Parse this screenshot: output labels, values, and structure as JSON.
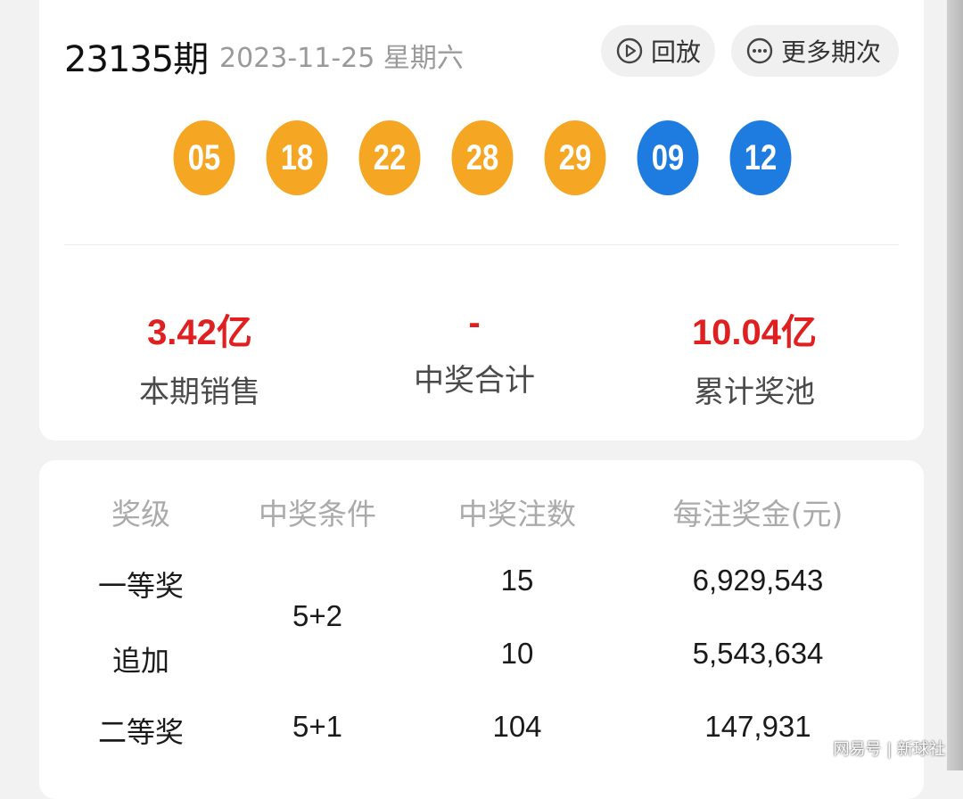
{
  "header": {
    "issue": "23135期",
    "date": "2023-11-25 星期六",
    "replay_label": "回放",
    "more_label": "更多期次"
  },
  "balls": {
    "front": [
      "05",
      "18",
      "22",
      "28",
      "29"
    ],
    "back": [
      "09",
      "12"
    ],
    "colors": {
      "front": "#f5a623",
      "back": "#1e7be0"
    }
  },
  "stats": [
    {
      "value": "3.42亿",
      "label": "本期销售"
    },
    {
      "value": "-",
      "label": "中奖合计"
    },
    {
      "value": "10.04亿",
      "label": "累计奖池"
    }
  ],
  "prize_table": {
    "headers": [
      "奖级",
      "中奖条件",
      "中奖注数",
      "每注奖金(元)"
    ],
    "rows": [
      {
        "level": "一等奖",
        "condition": "5+2",
        "count": "15",
        "amount": "6,929,543"
      },
      {
        "level": "追加",
        "condition": "",
        "count": "10",
        "amount": "5,543,634"
      },
      {
        "level": "二等奖",
        "condition": "5+1",
        "count": "104",
        "amount": "147,931"
      }
    ]
  },
  "watermark": "网易号 | 新球社"
}
